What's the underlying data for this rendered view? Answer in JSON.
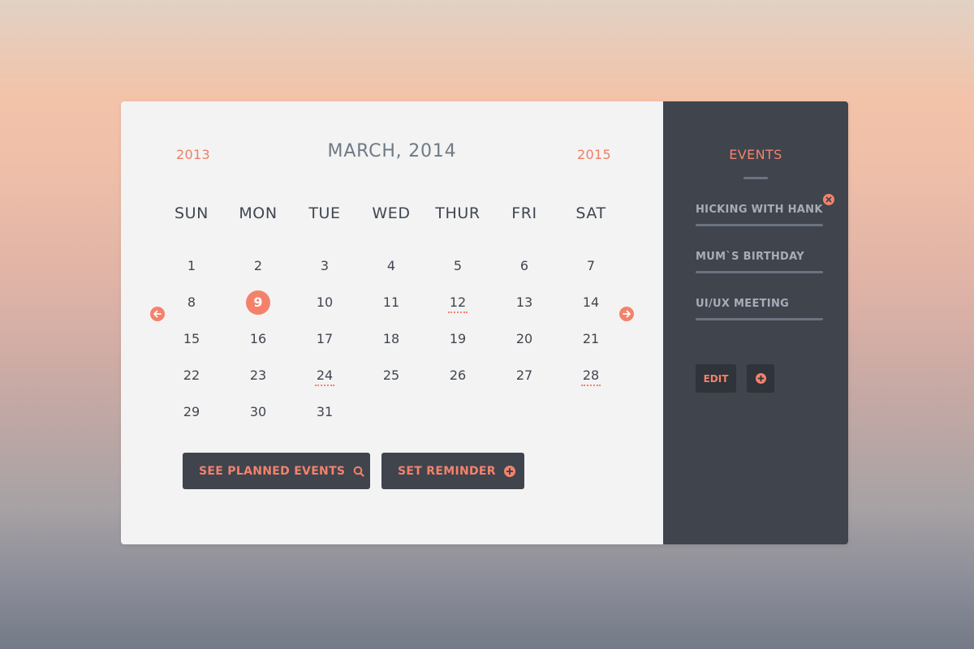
{
  "calendar": {
    "prev_year": "2013",
    "next_year": "2015",
    "month_title": "MARCH, 2014",
    "weekdays": [
      "SUN",
      "MON",
      "TUE",
      "WED",
      "THUR",
      "FRI",
      "SAT"
    ],
    "weeks": [
      [
        "1",
        "2",
        "3",
        "4",
        "5",
        "6",
        "7"
      ],
      [
        "8",
        "9",
        "10",
        "11",
        "12",
        "13",
        "14"
      ],
      [
        "15",
        "16",
        "17",
        "18",
        "19",
        "20",
        "21"
      ],
      [
        "22",
        "23",
        "24",
        "25",
        "26",
        "27",
        "28"
      ],
      [
        "29",
        "30",
        "31",
        "",
        "",
        "",
        ""
      ]
    ],
    "selected_day": "9",
    "event_days": [
      "12",
      "24",
      "28"
    ],
    "prev_icon": "arrow-left-circle-icon",
    "next_icon": "arrow-right-circle-icon",
    "see_planned_label": "SEE PLANNED EVENTS",
    "see_planned_icon": "search-icon",
    "set_reminder_label": "SET REMINDER",
    "set_reminder_icon": "plus-circle-icon"
  },
  "events": {
    "title": "EVENTS",
    "items": [
      {
        "label": "HICKING WITH HANK"
      },
      {
        "label": "MUM`S BIRTHDAY"
      },
      {
        "label": "UI/UX MEETING"
      }
    ],
    "remove_icon": "close-circle-icon",
    "edit_label": "EDIT",
    "add_icon": "plus-circle-icon"
  },
  "colors": {
    "accent": "#f4826b",
    "panel_dark": "#3f444d",
    "panel_light": "#f3f3f3",
    "text_dark": "#404650",
    "text_muted": "#a7adb8"
  }
}
